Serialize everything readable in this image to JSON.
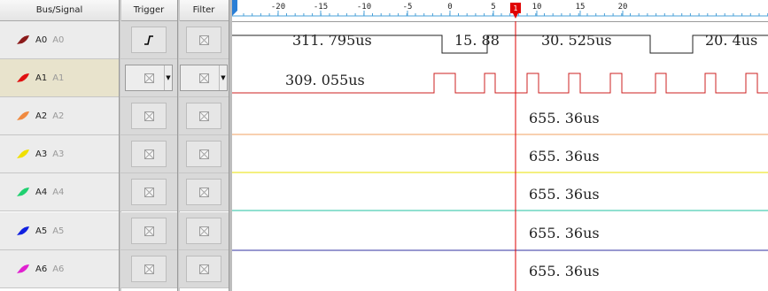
{
  "header": {
    "bus_signal": "Bus/Signal",
    "trigger": "Trigger",
    "filter": "Filter"
  },
  "ruler": {
    "ticks": [
      "-20",
      "-15",
      "-10",
      "-5",
      "0",
      "5",
      "10",
      "15",
      "20"
    ],
    "cursor_label": "1"
  },
  "channels": [
    {
      "name": "A0",
      "alias": "A0",
      "color": "#8b1a1a"
    },
    {
      "name": "A1",
      "alias": "A1",
      "color": "#e01010"
    },
    {
      "name": "A2",
      "alias": "A2",
      "color": "#f08a40"
    },
    {
      "name": "A3",
      "alias": "A3",
      "color": "#f0e000"
    },
    {
      "name": "A4",
      "alias": "A4",
      "color": "#20d070"
    },
    {
      "name": "A5",
      "alias": "A5",
      "color": "#1020e0"
    },
    {
      "name": "A6",
      "alias": "A6",
      "color": "#e020d0"
    }
  ],
  "trace_colors": {
    "a0": "#222222",
    "a1": "#cc2020",
    "a2": "#f0a060",
    "a3": "#e8e000",
    "a4": "#20c0a0",
    "a5": "#3030a0",
    "cursor": "#dd0000"
  },
  "measurements": {
    "a0_1": "311. 795us",
    "a0_2": "15. 88",
    "a0_3": "30. 525us",
    "a0_4": "20. 4us",
    "a1_1": "309. 055us",
    "a2": "655. 36us",
    "a3": "655. 36us",
    "a4": "655. 36us",
    "a5": "655. 36us",
    "a6": "655. 36us"
  }
}
